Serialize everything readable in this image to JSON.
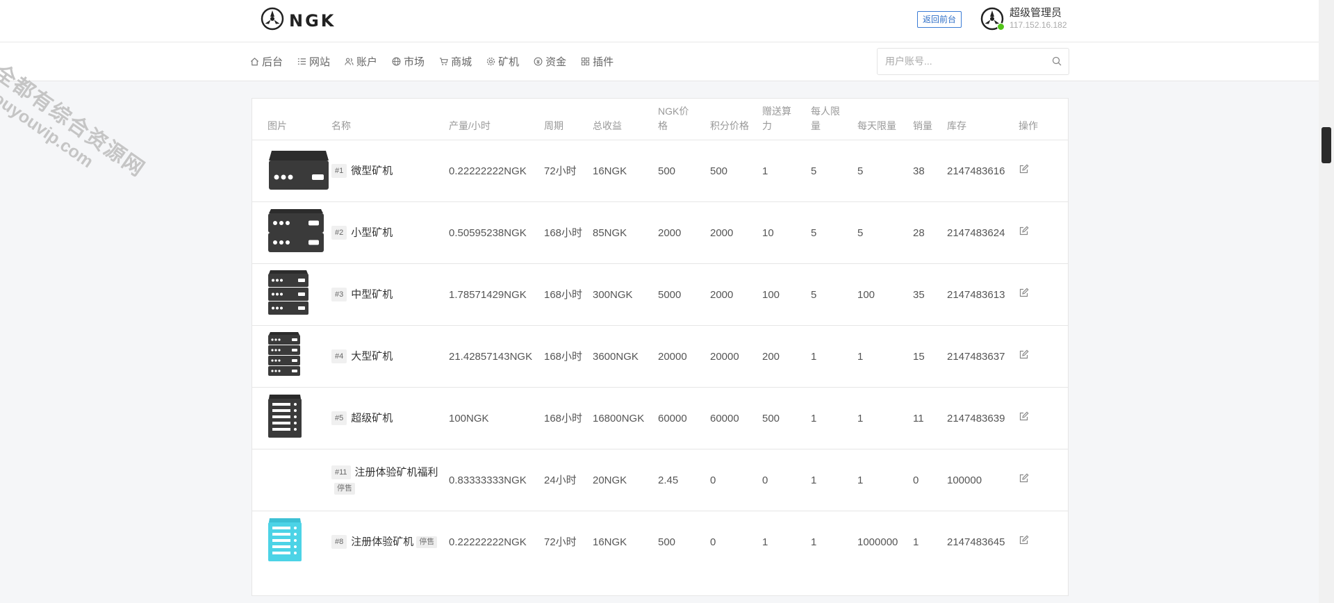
{
  "brand": {
    "name": "NGK"
  },
  "header": {
    "back_label": "返回前台",
    "user_name": "超级管理员",
    "user_ip": "117.152.16.182"
  },
  "nav": [
    {
      "label": "后台",
      "icon": "home-icon"
    },
    {
      "label": "网站",
      "icon": "list-icon"
    },
    {
      "label": "账户",
      "icon": "users-icon"
    },
    {
      "label": "市场",
      "icon": "globe-icon"
    },
    {
      "label": "商城",
      "icon": "cart-icon"
    },
    {
      "label": "矿机",
      "icon": "gear-icon"
    },
    {
      "label": "资金",
      "icon": "coin-icon"
    },
    {
      "label": "插件",
      "icon": "grid-icon"
    }
  ],
  "search": {
    "placeholder": "用户账号..."
  },
  "table": {
    "columns": {
      "image": "图片",
      "name": "名称",
      "output": "产量/小时",
      "period": "周期",
      "total": "总收益",
      "ngk_price": "NGK价格",
      "points_price": "积分价格",
      "bonus": "赠送算力",
      "per_person": "每人限量",
      "per_day": "每天限量",
      "sales": "销量",
      "stock": "库存",
      "action": "操作"
    },
    "rows": [
      {
        "id": "#1",
        "name": "微型矿机",
        "status": "",
        "image": "micro",
        "output": "0.22222222NGK",
        "period": "72小时",
        "total": "16NGK",
        "ngk_price": "500",
        "points_price": "500",
        "bonus": "1",
        "per_person": "5",
        "per_day": "5",
        "sales": "38",
        "stock": "2147483616"
      },
      {
        "id": "#2",
        "name": "小型矿机",
        "status": "",
        "image": "small",
        "output": "0.50595238NGK",
        "period": "168小时",
        "total": "85NGK",
        "ngk_price": "2000",
        "points_price": "2000",
        "bonus": "10",
        "per_person": "5",
        "per_day": "5",
        "sales": "28",
        "stock": "2147483624"
      },
      {
        "id": "#3",
        "name": "中型矿机",
        "status": "",
        "image": "medium",
        "output": "1.78571429NGK",
        "period": "168小时",
        "total": "300NGK",
        "ngk_price": "5000",
        "points_price": "2000",
        "bonus": "100",
        "per_person": "5",
        "per_day": "100",
        "sales": "35",
        "stock": "2147483613"
      },
      {
        "id": "#4",
        "name": "大型矿机",
        "status": "",
        "image": "large",
        "output": "21.42857143NGK",
        "period": "168小时",
        "total": "3600NGK",
        "ngk_price": "20000",
        "points_price": "20000",
        "bonus": "200",
        "per_person": "1",
        "per_day": "1",
        "sales": "15",
        "stock": "2147483637"
      },
      {
        "id": "#5",
        "name": "超级矿机",
        "status": "",
        "image": "super",
        "output": "100NGK",
        "period": "168小时",
        "total": "16800NGK",
        "ngk_price": "60000",
        "points_price": "60000",
        "bonus": "500",
        "per_person": "1",
        "per_day": "1",
        "sales": "11",
        "stock": "2147483639"
      },
      {
        "id": "#11",
        "name": "注册体验矿机福利",
        "status": "停售",
        "image": "",
        "output": "0.83333333NGK",
        "period": "24小时",
        "total": "20NGK",
        "ngk_price": "2.45",
        "points_price": "0",
        "bonus": "0",
        "per_person": "1",
        "per_day": "1",
        "sales": "0",
        "stock": "100000"
      },
      {
        "id": "#8",
        "name": "注册体验矿机",
        "status": "停售",
        "image": "trial",
        "output": "0.22222222NGK",
        "period": "72小时",
        "total": "16NGK",
        "ngk_price": "500",
        "points_price": "0",
        "bonus": "1",
        "per_person": "1",
        "per_day": "1000000",
        "sales": "1",
        "stock": "2147483645"
      }
    ]
  },
  "watermark": {
    "line1": "全都有综合资源网",
    "line2": "douyouvip.com"
  }
}
